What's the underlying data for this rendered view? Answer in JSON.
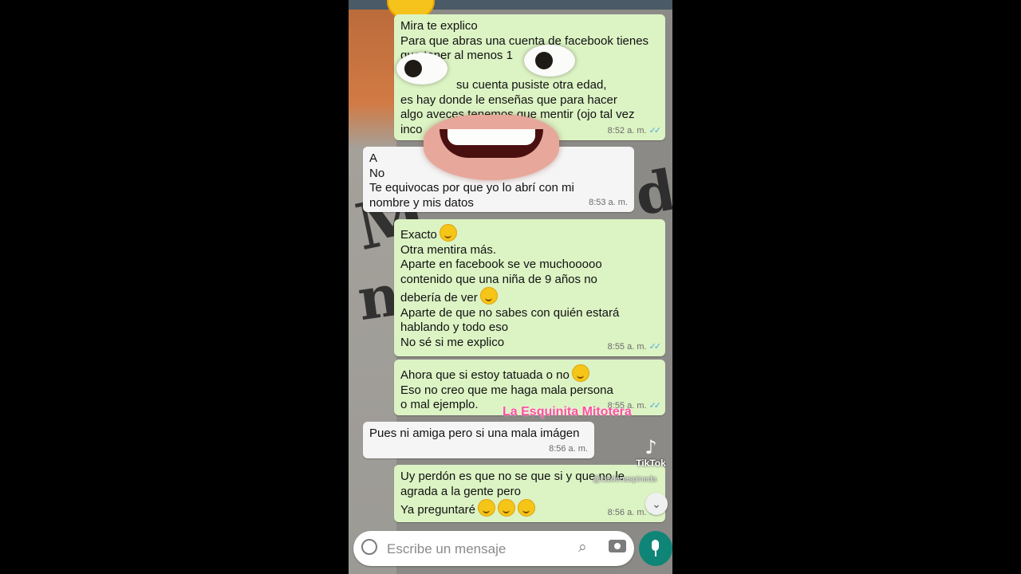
{
  "messages": [
    {
      "lines": [
        "Mira te explico",
        "Para que abras una cuenta de facebook tienes",
        "que tener al menos 1",
        "",
        "su cuenta pusiste otra edad,",
        "es hay donde le enseñas que para hacer",
        "algo aveces tenemos que mentir (ojo tal vez",
        "inco"
      ],
      "time": "8:52 a. m."
    },
    {
      "lines": [
        "A",
        "No",
        "Te equivocas por que yo lo abrí con mi",
        "nombre y mis datos"
      ],
      "time": "8:53 a. m."
    },
    {
      "lines": [
        "Exacto",
        "Otra mentira más.",
        "Aparte en facebook se ve muchooooo",
        "contenido que una niña de 9 años no",
        "debería de ver",
        "Aparte de que no sabes con quién estará",
        "hablando y todo eso",
        "No sé si me explico"
      ],
      "time": "8:55 a. m."
    },
    {
      "lines": [
        "Ahora que si estoy tatuada o no",
        "Eso no creo que me haga mala persona",
        "o mal ejemplo."
      ],
      "time": "8:55 a. m."
    },
    {
      "lines": [
        "Pues ni amiga pero si una mala imágen"
      ],
      "time": "8:56 a. m."
    },
    {
      "lines": [
        "Uy perdón es que no se que si y que no le",
        "agrada a la gente pero",
        "Ya preguntaré"
      ],
      "time": "8:56 a. m."
    }
  ],
  "overlay": {
    "watermark": "La Esquinita Mitotera",
    "tiktok_brand": "TikTok",
    "tiktok_user": "@caldenaspineda"
  },
  "composer": {
    "placeholder": "Escribe un mensaje"
  },
  "icons": {
    "emoji_button": "smile-icon",
    "attach": "paperclip-icon",
    "camera": "camera-icon",
    "mic": "mic-icon",
    "scroll": "chevron-double-down-icon"
  },
  "colors": {
    "outgoing_bubble": "#dcf3c4",
    "incoming_bubble": "#f5f5f5",
    "read_ticks": "#4fa8e0",
    "mic_button": "#0f8577",
    "watermark": "#ff4fa3"
  }
}
